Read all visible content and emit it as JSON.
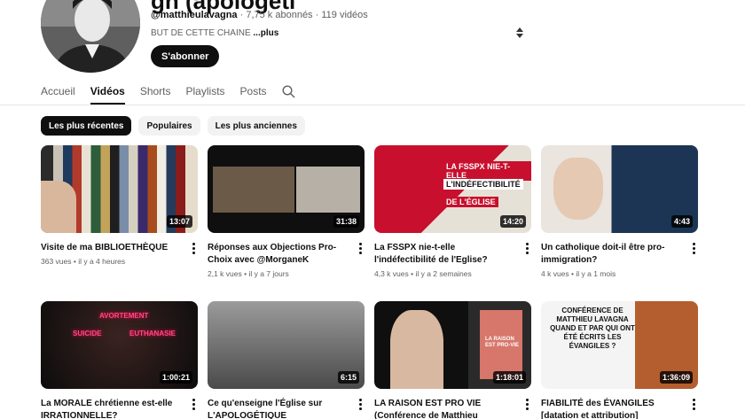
{
  "channel": {
    "name_partial": "gn (apologeti",
    "handle": "@matthieulavagna",
    "subscribers": "7,75 k abonnés",
    "videos_count": "119 vidéos",
    "about": "BUT DE CETTE CHAINE",
    "about_more": "...plus",
    "subscribe_label": "S'abonner"
  },
  "tabs": [
    {
      "label": "Accueil"
    },
    {
      "label": "Vidéos"
    },
    {
      "label": "Shorts"
    },
    {
      "label": "Playlists"
    },
    {
      "label": "Posts"
    }
  ],
  "chips": [
    {
      "label": "Les plus récentes"
    },
    {
      "label": "Populaires"
    },
    {
      "label": "Les plus anciennes"
    }
  ],
  "videos": [
    {
      "title": "Visite de ma BIBLIOETHÈQUE",
      "views": "363 vues",
      "age": "il y a 4 heures",
      "duration": "13:07"
    },
    {
      "title": "Réponses aux Objections Pro-Choix avec @MorganeK",
      "views": "2,1 k vues",
      "age": "il y a 7 jours",
      "duration": "31:38"
    },
    {
      "title": "La FSSPX nie-t-elle l'indéfectibilité de l'Eglise?",
      "views": "4,3 k vues",
      "age": "il y a 2 semaines",
      "duration": "14:20"
    },
    {
      "title": "Un catholique doit-il être pro-immigration?",
      "views": "4 k vues",
      "age": "il y a 1 mois",
      "duration": "4:43"
    },
    {
      "title": "La MORALE chrétienne est-elle IRRATIONNELLE?",
      "views": "",
      "age": "",
      "duration": "1:00:21"
    },
    {
      "title": "Ce qu'enseigne l'Église sur L'APOLOGÉTIQUE",
      "views": "",
      "age": "",
      "duration": "6:15"
    },
    {
      "title": "LA RAISON EST PRO VIE (Conférence de Matthieu Lavagna...",
      "views": "",
      "age": "",
      "duration": "1:18:01"
    },
    {
      "title": "FIABILITÉ des ÉVANGILES [datation et attribution] (conférence de...",
      "views": "",
      "age": "",
      "duration": "1:36:09"
    }
  ],
  "thumb_text": {
    "fsspx_1": "LA FSSPX NIE-T-ELLE",
    "fsspx_2": "L'INDÉFECTIBILITÉ",
    "fsspx_3": "DE L'ÉGLISE",
    "morale_1": "AVORTEMENT",
    "morale_2": "SUICIDE",
    "morale_3": "EUTHANASIE",
    "book": "LA RAISON EST PRO-VIE",
    "conf": "CONFÉRENCE DE MATTHIEU LAVAGNA QUAND ET PAR QUI ONT ÉTÉ ÉCRITS LES ÉVANGILES ?"
  }
}
